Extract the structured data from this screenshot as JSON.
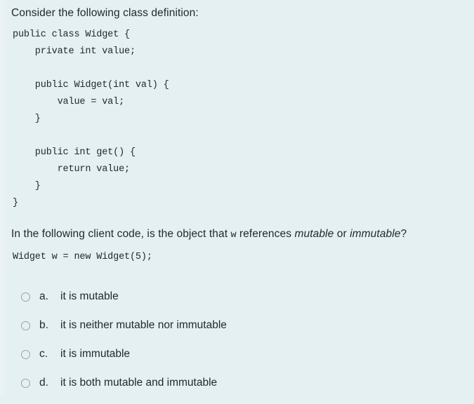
{
  "background_color": "#e5f0f2",
  "text_color": "#22292c",
  "radio_border_color": "#9aa4a8",
  "intro": {
    "text": "Consider the following class definition:"
  },
  "class_code": {
    "lines": [
      "public class Widget {",
      "    private int value;",
      "",
      "    public Widget(int val) {",
      "        value = val;",
      "    }",
      "",
      "    public int get() {",
      "        return value;",
      "    }",
      "}"
    ],
    "full_text": "public class Widget {\n    private int value;\n\n    public Widget(int val) {\n        value = val;\n    }\n\n    public int get() {\n        return value;\n    }\n}"
  },
  "question": {
    "part1": "In the following client code, is the object that ",
    "variable": "w",
    "part2": " references ",
    "italic1": "mutable",
    "part3": " or ",
    "italic2": "immutable",
    "part4": "?"
  },
  "client_code": {
    "full_text": "Widget w = new Widget(5);"
  },
  "options": [
    {
      "letter": "a.",
      "text": "it is mutable",
      "selected": false
    },
    {
      "letter": "b.",
      "text": "it is neither mutable nor immutable",
      "selected": false
    },
    {
      "letter": "c.",
      "text": "it is immutable",
      "selected": false
    },
    {
      "letter": "d.",
      "text": "it is both mutable and immutable",
      "selected": false
    }
  ]
}
